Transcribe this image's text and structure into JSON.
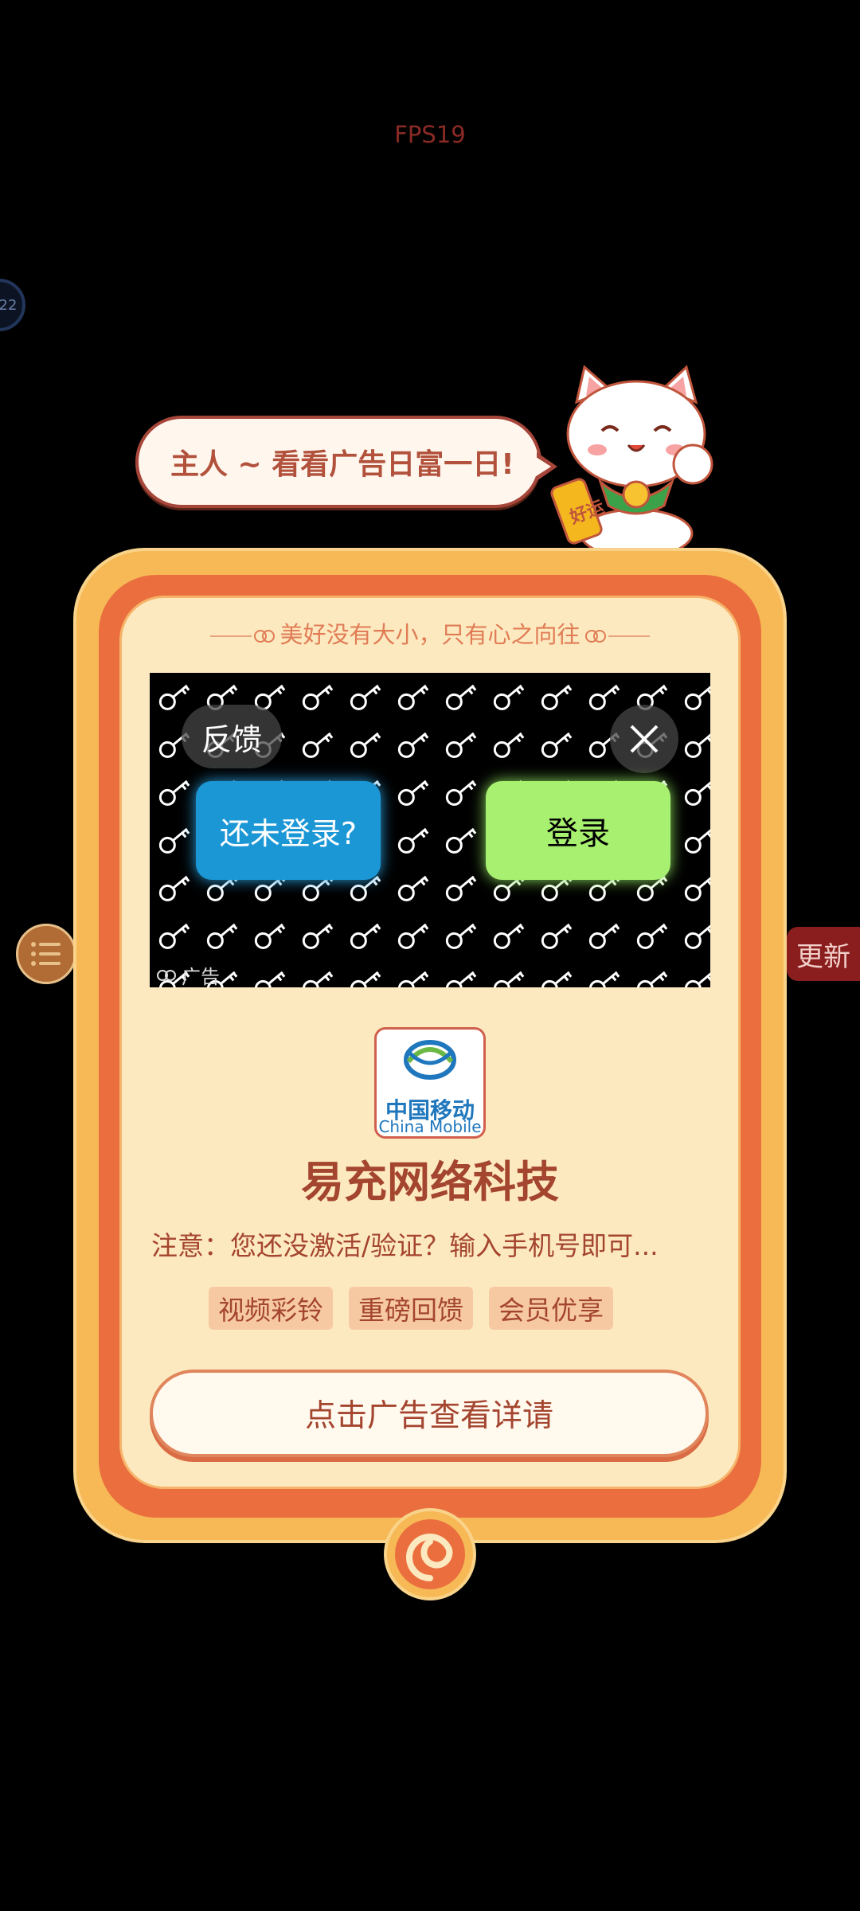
{
  "status": {
    "fps": "FPS19",
    "side_circle_text": "22"
  },
  "side": {
    "update_label": "更新",
    "list_icon": "list-icon"
  },
  "bubble": {
    "text": "主人 ~ 看看广告日富一日!"
  },
  "mascot": {
    "badge_text": "好运"
  },
  "frame": {
    "motto": "美好没有大小，只有心之向往"
  },
  "ad": {
    "feedback_label": "反馈",
    "not_logged_label": "还未登录?",
    "login_label": "登录",
    "ad_tag": "广告"
  },
  "advertiser": {
    "logo_cn": "中国移动",
    "logo_en": "China Mobile",
    "name": "易充网络科技",
    "notice": "注意：您还没激活/验证？输入手机号即可...",
    "tags": [
      "视频彩铃",
      "重磅回馈",
      "会员优享"
    ],
    "cta_label": "点击广告查看详请"
  },
  "colors": {
    "background": "#000000",
    "frame_gold": "#f7b955",
    "frame_orange": "#ea6e3e",
    "frame_cream": "#fde9bf",
    "text_brown": "#a4452f",
    "ad_blue": "#1b97d6",
    "ad_green": "#a8f070"
  }
}
